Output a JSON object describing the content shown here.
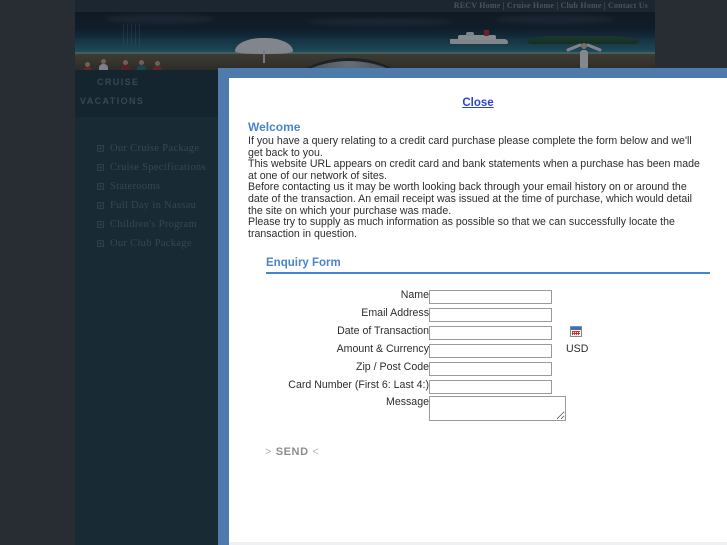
{
  "site": {
    "topnav": "RECV Home | Cruise Home | Club Home | Contact Us",
    "brand_line1": "CRUISE",
    "brand_line2": "VACATIONS",
    "nav_items": [
      {
        "label": "Our Cruise Package"
      },
      {
        "label": "Cruise Specifications"
      },
      {
        "label": "Staterooms"
      },
      {
        "label": "Full Day in Nassau"
      },
      {
        "label": "Children's Program"
      },
      {
        "label": "Our Club Package"
      }
    ]
  },
  "modal": {
    "close_label": "Close",
    "welcome_heading": "Welcome",
    "intro_paragraphs": [
      "If you have a query relating to a credit card purchase please complete the form below and we'll get back to you.",
      "This website URL appears on credit card and bank statements when a purchase has been made at one of our network of sites.",
      "Before contacting us it may be worth looking back through your email history on or around the date of the transaction. An email receipt was issued at the time of purchase, which would detail the site on which your purchase was made.",
      "Please try to supply as much information as possible so that we can successfully locate the transaction in question."
    ],
    "form_heading": "Enquiry Form",
    "fields": [
      {
        "label": "Name",
        "value": "",
        "placeholder": ""
      },
      {
        "label": "Email Address",
        "value": "",
        "placeholder": ""
      },
      {
        "label": "Date of Transaction",
        "value": "",
        "placeholder": ""
      },
      {
        "label": "Amount & Currency",
        "value": "",
        "placeholder": ""
      },
      {
        "label": "Zip / Post Code",
        "value": "",
        "placeholder": ""
      },
      {
        "label": "Card Number (First 6: Last 4:)",
        "value": "",
        "placeholder": ""
      },
      {
        "label": "Message",
        "value": "",
        "placeholder": ""
      }
    ],
    "currency_suffix": "USD",
    "date_picker_icon": "calendar-icon",
    "send_label": "SEND",
    "send_chev_left": ">",
    "send_chev_right": "<"
  },
  "colors": {
    "modal_border": "#4f7bac",
    "accent_blue": "#4a86c8",
    "rule_blue": "#3f86d8",
    "link_blue": "#2c43d4",
    "sidebar_bg": "#25404e",
    "page_bg": "#41464d"
  }
}
